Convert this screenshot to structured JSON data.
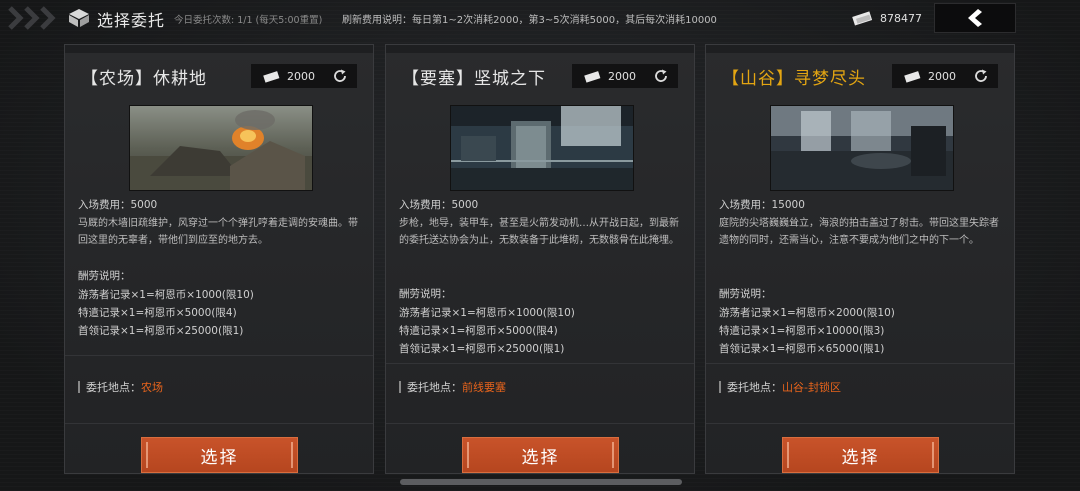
{
  "header": {
    "title": "选择委托",
    "daily_count": "今日委托次数: 1/1 (每天5:00重置)",
    "refresh_note": "刷新费用说明：每日第1~2次消耗2000，第3~5次消耗5000，其后每次消耗10000",
    "currency_value": "878477",
    "currency_icon": "ticket-icon",
    "back_icon": "chevron-left-icon"
  },
  "colors": {
    "accent_orange": "#e8641c",
    "gold": "#e3a512",
    "button_bg": "#c0502a"
  },
  "common": {
    "entry_label": "入场费用：",
    "reward_label": "酬劳说明：",
    "location_label": "委托地点：",
    "select_label": "选择"
  },
  "cards": [
    {
      "name": "【农场】休耕地",
      "cost": "2000",
      "entry_fee": "入场费用：5000",
      "description": "马厩的木墙旧疏维护，风穿过一个个弹孔哼着走调的安魂曲。带回这里的无辜者，带他们到应至的地方去。",
      "rewards": [
        "游荡者记录×1=柯恩币×1000(限10)",
        "特遣记录×1=柯恩币×5000(限4)",
        "首领记录×1=柯恩币×25000(限1)"
      ],
      "location": "农场",
      "location_line": "委托地点："
    },
    {
      "name": "【要塞】坚城之下",
      "cost": "2000",
      "entry_fee": "入场费用：5000",
      "description": "步枪，地导，装甲车，甚至是火箭发动机…从开战日起，到最新的委托送达协会为止，无数装备于此堆砌，无数骸骨在此掩埋。",
      "rewards": [
        "游荡者记录×1=柯恩币×1000(限10)",
        "特遣记录×1=柯恩币×5000(限4)",
        "首领记录×1=柯恩币×25000(限1)"
      ],
      "location": "前线要塞",
      "location_line": "委托地点："
    },
    {
      "name": "【山谷】寻梦尽头",
      "cost": "2000",
      "entry_fee": "入场费用：15000",
      "description": "庭院的尖塔巍巍耸立，海浪的拍击盖过了射击。带回这里失踪者遗物的同时，还需当心，注意不要成为他们之中的下一个。",
      "rewards": [
        "游荡者记录×1=柯恩币×2000(限10)",
        "特遣记录×1=柯恩币×10000(限3)",
        "首领记录×1=柯恩币×65000(限1)"
      ],
      "location": "山谷-封锁区",
      "location_line": "委托地点："
    }
  ]
}
